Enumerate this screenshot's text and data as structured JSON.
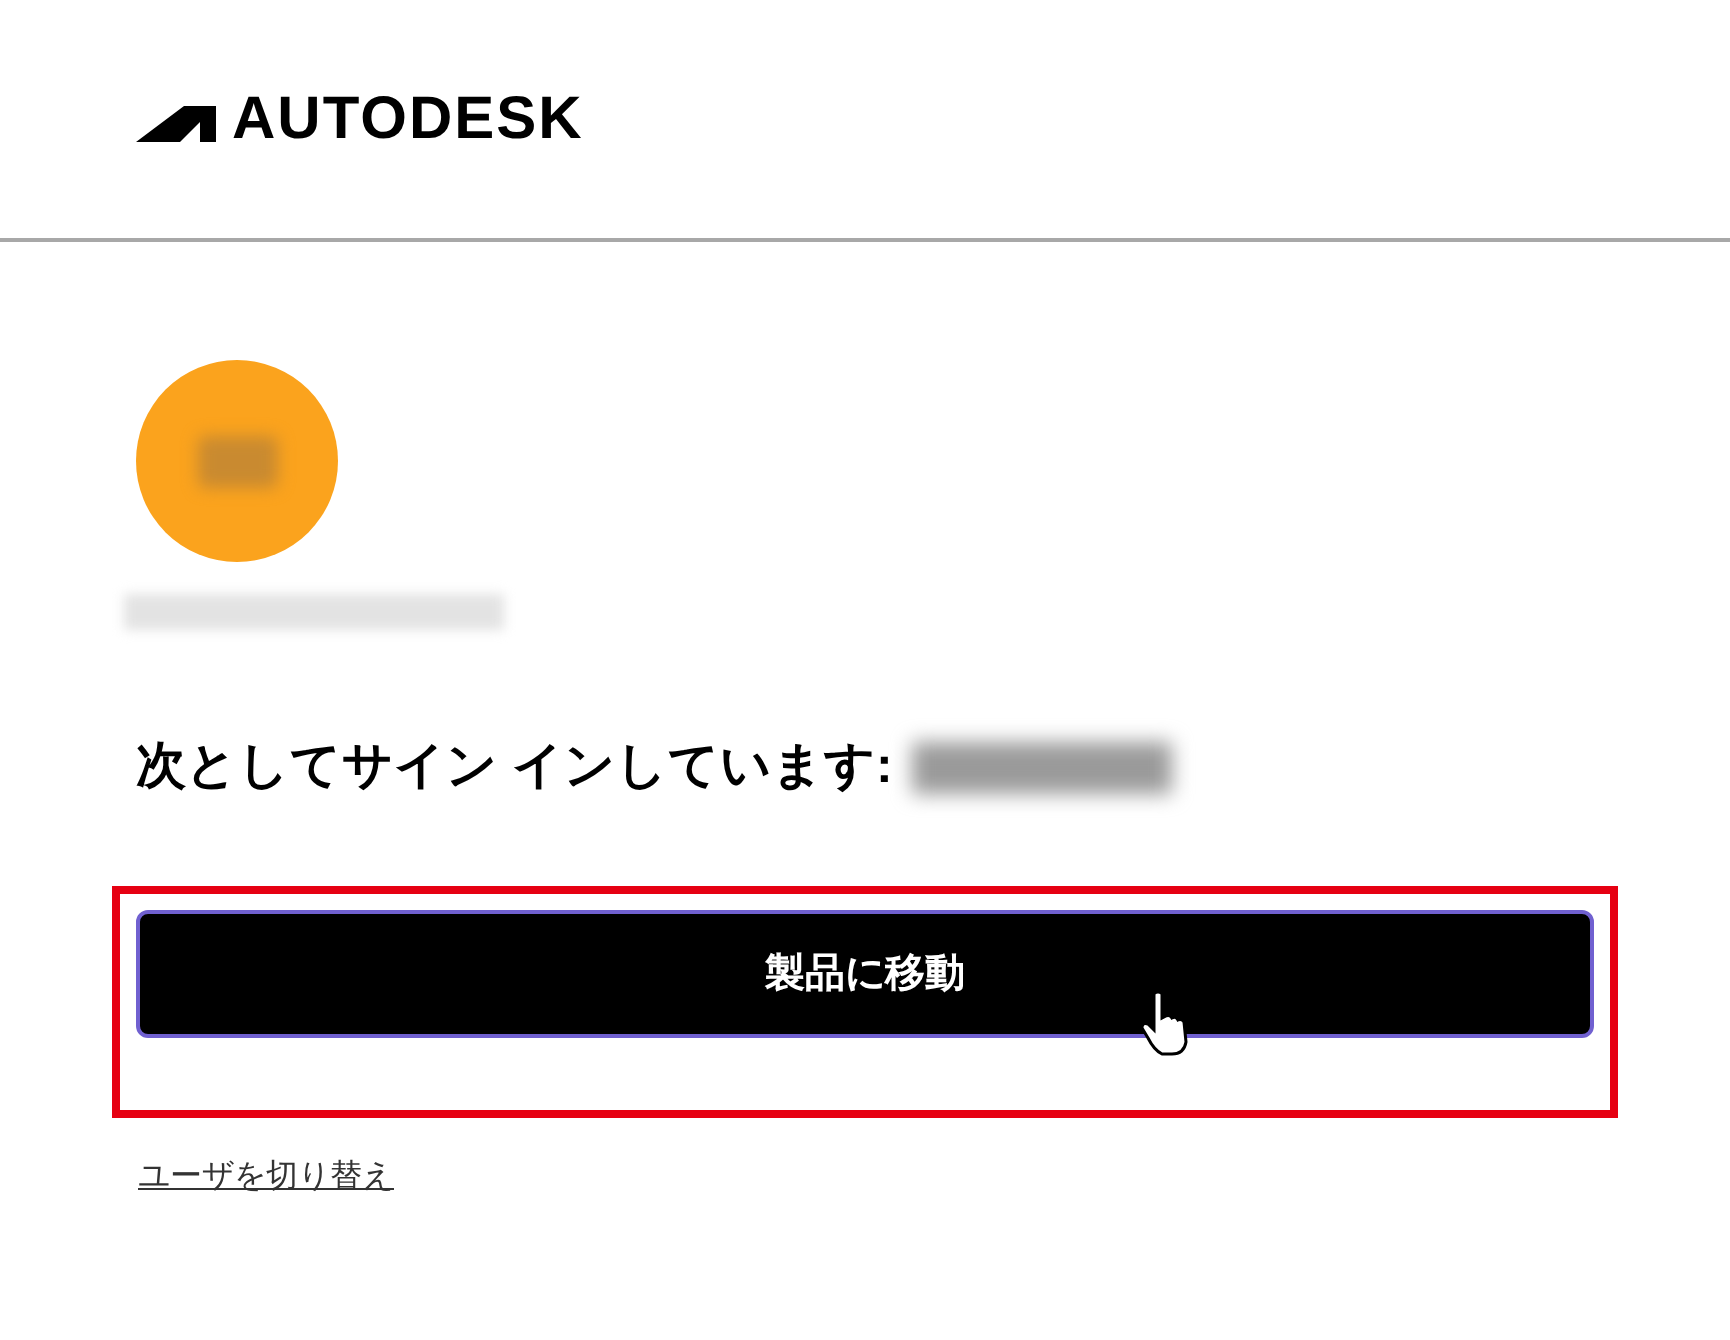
{
  "header": {
    "logo_text": "AUTODESK"
  },
  "account": {
    "signed_in_label": "次としてサイン インしています:"
  },
  "primary_button": {
    "label": "製品に移動",
    "highlighted": true
  },
  "switch_user_link": "ユーザを切り替え"
}
